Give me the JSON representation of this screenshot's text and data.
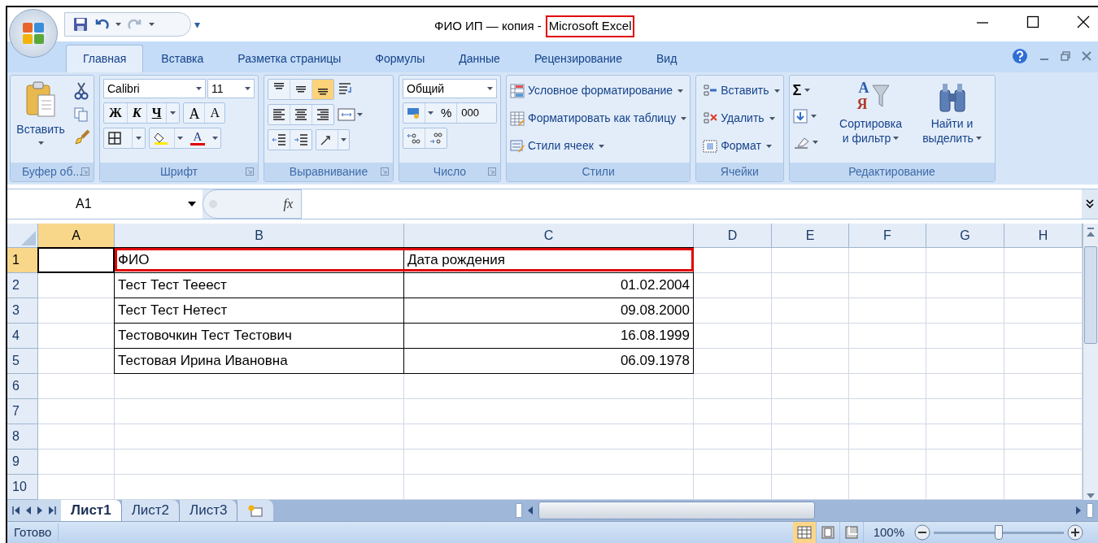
{
  "window": {
    "title": "ФИО ИП — копия -",
    "app_name": "Microsoft Excel",
    "app_name_highlighted": true,
    "customize_mark": "▾"
  },
  "tabs": [
    {
      "label": "Главная",
      "selected": true
    },
    {
      "label": "Вставка",
      "selected": false
    },
    {
      "label": "Разметка страницы",
      "selected": false
    },
    {
      "label": "Формулы",
      "selected": false
    },
    {
      "label": "Данные",
      "selected": false
    },
    {
      "label": "Рецензирование",
      "selected": false
    },
    {
      "label": "Вид",
      "selected": false
    }
  ],
  "ribbon": {
    "clipboard": {
      "label": "Буфер об...",
      "paste": "Вставить"
    },
    "font": {
      "label": "Шрифт",
      "font_name": "Calibri",
      "font_size": "11",
      "bold": "Ж",
      "italic": "К",
      "underline": "Ч",
      "grow": "A",
      "shrink": "A",
      "font_color": "A"
    },
    "alignment": {
      "label": "Выравнивание",
      "vertical": [
        {
          "kind": "top",
          "selected": false
        },
        {
          "kind": "middle",
          "selected": false
        },
        {
          "kind": "bottom",
          "selected": true
        }
      ]
    },
    "number": {
      "label": "Число",
      "format": "Общий",
      "percent": "%",
      "thousands": "000"
    },
    "styles": {
      "label": "Стили",
      "items": [
        "Условное форматирование",
        "Форматировать как таблицу",
        "Стили ячеек"
      ]
    },
    "cells": {
      "label": "Ячейки",
      "items": [
        "Вставить",
        "Удалить",
        "Формат"
      ]
    },
    "editing": {
      "label": "Редактирование",
      "autosum": "Σ",
      "sort_letters": [
        "А",
        "Я"
      ],
      "sort": [
        "Сортировка",
        "и фильтр"
      ],
      "find": [
        "Найти и",
        "выделить"
      ]
    }
  },
  "formula_bar": {
    "name_box": "A1",
    "fx": "fx"
  },
  "columns": [
    {
      "label": "A",
      "selected": true
    },
    {
      "label": "B",
      "selected": false
    },
    {
      "label": "C",
      "selected": false
    },
    {
      "label": "D",
      "selected": false
    },
    {
      "label": "E",
      "selected": false
    },
    {
      "label": "F",
      "selected": false
    },
    {
      "label": "G",
      "selected": false
    },
    {
      "label": "H",
      "selected": false
    }
  ],
  "rows": [
    {
      "number": "1",
      "selected": true,
      "kind": "header",
      "name": "ФИО",
      "date": "Дата рождения",
      "highlighted": true
    },
    {
      "number": "2",
      "selected": false,
      "kind": "data",
      "name": "Тест Тест Тееест",
      "date": "01.02.2004",
      "highlighted": false
    },
    {
      "number": "3",
      "selected": false,
      "kind": "data",
      "name": "Тест Тест Нетест",
      "date": "09.08.2000",
      "highlighted": false
    },
    {
      "number": "4",
      "selected": false,
      "kind": "data",
      "name": "Тестовочкин Тест Тестович",
      "date": "16.08.1999",
      "highlighted": false
    },
    {
      "number": "5",
      "selected": false,
      "kind": "data",
      "name": "Тестовая Ирина Ивановна",
      "date": "06.09.1978",
      "highlighted": false
    },
    {
      "number": "6",
      "selected": false,
      "kind": "empty"
    },
    {
      "number": "7",
      "selected": false,
      "kind": "empty"
    },
    {
      "number": "8",
      "selected": false,
      "kind": "empty"
    },
    {
      "number": "9",
      "selected": false,
      "kind": "empty"
    },
    {
      "number": "10",
      "selected": false,
      "kind": "empty"
    }
  ],
  "sheet_tabs": [
    {
      "label": "Лист1",
      "selected": true
    },
    {
      "label": "Лист2",
      "selected": false
    },
    {
      "label": "Лист3",
      "selected": false
    }
  ],
  "status_bar": {
    "text": "Готово",
    "views": [
      {
        "kind": "normal",
        "selected": true
      },
      {
        "kind": "page_layout",
        "selected": false
      },
      {
        "kind": "page_break",
        "selected": false
      }
    ],
    "zoom": "100%",
    "zoom_slider": {
      "level": 0.5
    }
  }
}
